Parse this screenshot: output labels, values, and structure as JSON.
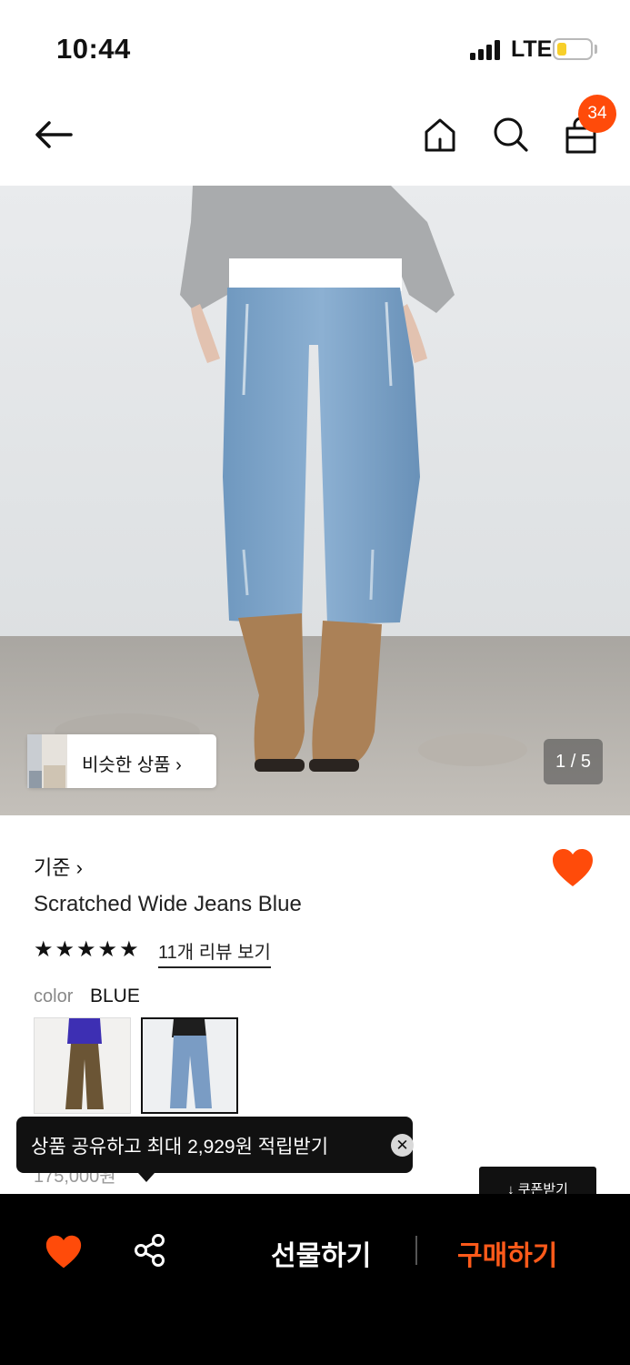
{
  "status_bar": {
    "time": "10:44",
    "network": "LTE"
  },
  "header": {
    "cart_count": "34"
  },
  "gallery": {
    "similar_label": "비슷한 상품 ›",
    "page_counter": "1 / 5"
  },
  "product": {
    "brand": "기준 ›",
    "name": "Scratched Wide Jeans Blue",
    "rating": 5,
    "review_link": "11개 리뷰 보기",
    "color_label": "color",
    "color_value": "BLUE",
    "price_peek": "175,000원"
  },
  "tooltip": {
    "text": "상품 공유하고 최대 2,929원 적립받기",
    "close_glyph": "✕"
  },
  "coupon": {
    "label": "↓ 쿠폰받기"
  },
  "bottom_bar": {
    "gift_label": "선물하기",
    "buy_label": "구매하기"
  },
  "colors": {
    "accent": "#ff4b0a",
    "buy": "#ff5a1a",
    "bar": "#000000",
    "liked": "#ff4b0a"
  }
}
